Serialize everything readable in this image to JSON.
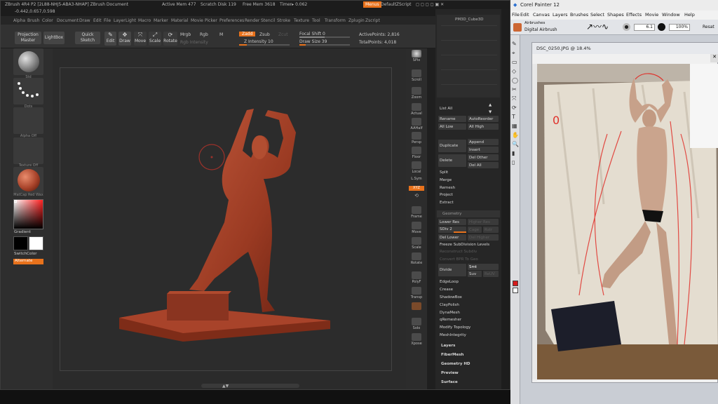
{
  "zbrush": {
    "title": "ZBrush 4R4 P2 [2L88-NHJ5-ABA3-NHAP]   ZBrush Document",
    "active_mem": "Active Mem 477",
    "scratch_disk": "Scratch Disk 119",
    "free_mem": "Free Mem 3618",
    "timer": "Timer▸ 0.062",
    "menus_btn": "Menus",
    "default_script": "DefaultZScript",
    "coords": "-0.442,0.657,0.598",
    "menu_items": [
      "Alpha",
      "Brush",
      "Color",
      "Document",
      "Draw",
      "Edit",
      "File",
      "Layer",
      "Light",
      "Macro",
      "Marker",
      "Material",
      "Movie",
      "Picker",
      "Preferences",
      "Render",
      "Stencil",
      "Stroke",
      "Texture",
      "Tool",
      "Transform",
      "Zplugin",
      "Zscript"
    ],
    "toolbar": {
      "projection_master": "Projection Master",
      "lightbox": "LightBox",
      "quick_sketch": "Quick Sketch",
      "edit": "Edit",
      "draw": "Draw",
      "move": "Move",
      "scale": "Scale",
      "rotate": "Rotate",
      "mrgb": "Mrgb",
      "rgb": "Rgb",
      "m": "M",
      "rgb_intensity": "Rgb Intensity",
      "zadd": "Zadd",
      "zsub": "Zsub",
      "zcut": "Zcut",
      "z_intensity": "Z Intensity 10",
      "focal_shift": "Focal Shift 0",
      "draw_size": "Draw Size 39",
      "active_points": "ActivePoints: 2,816",
      "total_points": "TotalPoints: 4,018"
    },
    "left_tray": {
      "brush_label": "Std",
      "stroke_label": "Dots",
      "alpha_label": "Alpha Off",
      "texture_label": "Texture Off",
      "material_label": "MatCap Red Wax",
      "gradient": "Gradient",
      "switch_color": "SwitchColor",
      "alternate": "Alternate"
    },
    "right_tray": [
      "SPix",
      "Scroll",
      "Zoom",
      "Actual",
      "AAHalf",
      "Persp",
      "Floor",
      "Local",
      "L.Sym",
      "XYZ",
      "Frame",
      "Move",
      "Scale",
      "Rotate",
      "PolyF",
      "Transp",
      "Solo",
      "Xpose"
    ],
    "subtool_panel": {
      "subtool_name": "PM3D_Cube3D",
      "list_all": "List All",
      "rename": "Rename",
      "auto_reorder": "AutoReorder",
      "all_low": "All Low",
      "all_high": "All High",
      "duplicate": "Duplicate",
      "append": "Append",
      "insert": "Insert",
      "delete": "Delete",
      "del_other": "Del Other",
      "del_all": "Del All",
      "split": "Split",
      "merge": "Merge",
      "remesh": "Remesh",
      "project": "Project",
      "extract": "Extract",
      "geometry": "Geometry",
      "lower_res": "Lower Res",
      "higher_res": "Higher Res",
      "sdiv": "SDiv 2",
      "cage": "Cage",
      "rstr": "Rstr",
      "del_lower": "Del Lower",
      "del_higher": "Del Higher",
      "freeze_subdivision": "Freeze SubDivision Levels",
      "reconstruct_subdiv": "Reconstruct Subdiv",
      "convert_bpr": "Convert BPR To Geo",
      "divide": "Divide",
      "smt": "Smt",
      "suv": "Suv",
      "reuv": "ReUV",
      "edgeloop": "EdgeLoop",
      "crease": "Crease",
      "shadowbox": "ShadowBox",
      "claypolish": "ClayPolish",
      "dynamesh": "DynaMesh",
      "qremesher": "qRemesher",
      "modify_topology": "Modify Topology",
      "meshintegrity": "MeshIntegrity",
      "layers": "Layers",
      "fibermesh": "FiberMesh",
      "geometry_hd": "Geometry HD",
      "preview": "Preview",
      "surface": "Surface"
    }
  },
  "painter": {
    "title": "Corel Painter 12",
    "menu": [
      "File",
      "Edit",
      "Canvas",
      "Layers",
      "Brushes",
      "Select",
      "Shapes",
      "Effects",
      "Movie",
      "Window",
      "Help"
    ],
    "brush_category": "Airbrushes",
    "brush_variant": "Digital Airbrush",
    "size": "6.1",
    "opacity": "100%",
    "resat": "Resat",
    "document_title": "DSC_0250.JPG @ 18.4%"
  },
  "colors": {
    "accent": "#e8721c",
    "clay": "#a8432a"
  }
}
